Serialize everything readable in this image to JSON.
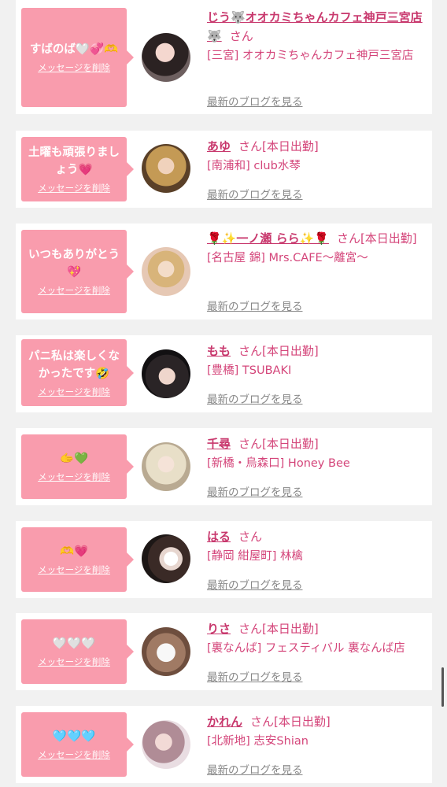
{
  "delete_label": "メッセージを削除",
  "blog_label": "最新のブログを見る",
  "san": "さん",
  "colors": {
    "bubble": "#f99cad",
    "name": "#c8386d",
    "link": "#d4457a",
    "background": "#f1f1f1"
  },
  "items": [
    {
      "message": "すばのば🤍💞🫶",
      "name": "じう🐺オオカミちゃんカフェ神戸三宮店🐺",
      "status": "",
      "shop": "[三宮] オオカミちゃんカフェ神戸三宮店",
      "avatar_icon": "avatar-1"
    },
    {
      "message": "土曜も頑張りましょう💗",
      "name": "あゆ",
      "status": "[本日出勤]",
      "shop": "[南浦和] club水琴",
      "avatar_icon": "avatar-2"
    },
    {
      "message": "いつもありがとう💖",
      "name": "🌹✨一ノ瀬 らら✨🌹",
      "status": "[本日出勤]",
      "shop": "[名古屋 錦] Mrs.CAFE〜離宮〜",
      "avatar_icon": "avatar-3"
    },
    {
      "message": "パニ私は楽しくなかったです🤣",
      "name": "もも",
      "status": "[本日出勤]",
      "shop": "[豊橋] TSUBAKI",
      "avatar_icon": "avatar-4"
    },
    {
      "message": "🫱💚",
      "name": "千尋",
      "status": "[本日出勤]",
      "shop": "[新橋・烏森口] Honey Bee",
      "avatar_icon": "avatar-5"
    },
    {
      "message": "🫶💗",
      "name": "はる",
      "status": "",
      "shop": "[静岡 紺屋町] 林檎",
      "avatar_icon": "avatar-6"
    },
    {
      "message": "🤍🤍🤍",
      "name": "りさ",
      "status": "[本日出勤]",
      "shop": "[裏なんば] フェスティバル 裏なんば店",
      "avatar_icon": "avatar-7"
    },
    {
      "message": "🩵🩵🩵",
      "name": "かれん",
      "status": "[本日出勤]",
      "shop": "[北新地] 志安Shian",
      "avatar_icon": "avatar-8"
    }
  ]
}
